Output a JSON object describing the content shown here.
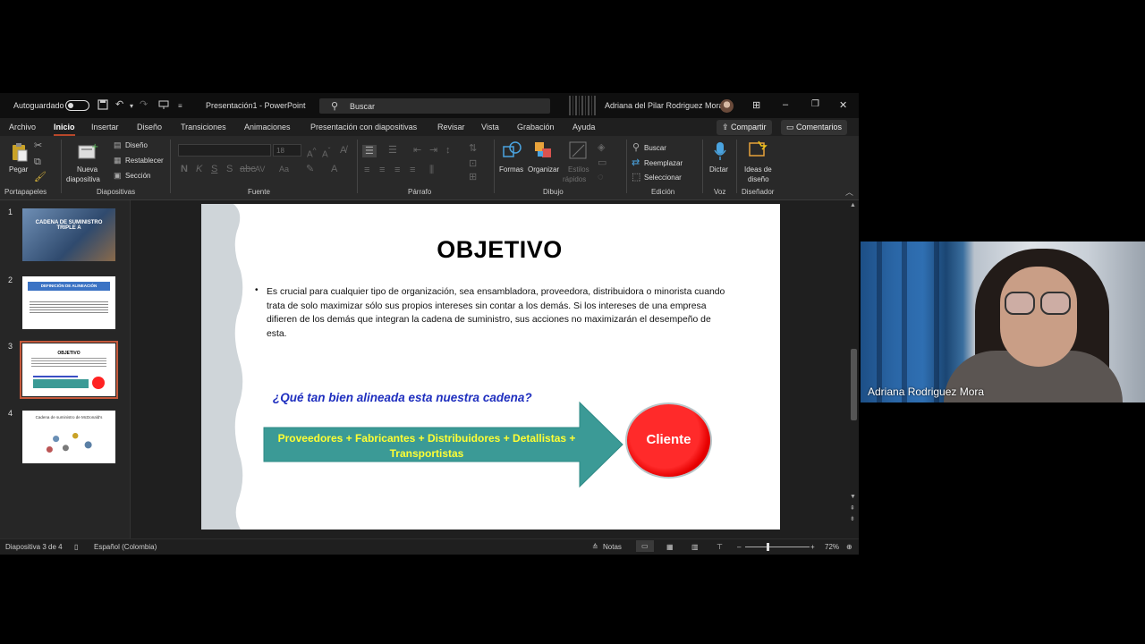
{
  "titlebar": {
    "autosave_label": "Autoguardado",
    "doc_title": "Presentación1  -  PowerPoint",
    "search_placeholder": "Buscar",
    "user_name": "Adriana del Pilar Rodriguez Mora"
  },
  "menu": {
    "tabs": [
      "Archivo",
      "Inicio",
      "Insertar",
      "Diseño",
      "Transiciones",
      "Animaciones",
      "Presentación con diapositivas",
      "Revisar",
      "Vista",
      "Grabación",
      "Ayuda"
    ],
    "active_tab": "Inicio",
    "share_label": "Compartir",
    "comments_label": "Comentarios"
  },
  "ribbon": {
    "groups": [
      "Portapapeles",
      "Diapositivas",
      "Fuente",
      "Párrafo",
      "Dibujo",
      "Edición",
      "Voz",
      "Diseñador"
    ],
    "paste": "Pegar",
    "new_slide_line1": "Nueva",
    "new_slide_line2": "diapositiva",
    "layout": "Diseño",
    "reset": "Restablecer",
    "section": "Sección",
    "font_size": "18",
    "shapes": "Formas",
    "arrange": "Organizar",
    "quick_styles_line1": "Estilos",
    "quick_styles_line2": "rápidos",
    "find": "Buscar",
    "replace": "Reemplazar",
    "select": "Seleccionar",
    "dictate": "Dictar",
    "design_ideas_line1": "Ideas de",
    "design_ideas_line2": "diseño"
  },
  "thumbnails": [
    {
      "num": "1",
      "title": "CADENA DE SUMINISTRO TRIPLE A"
    },
    {
      "num": "2",
      "title": "DEFINICIÓN DE ALINEACIÓN"
    },
    {
      "num": "3",
      "title": "OBJETIVO"
    },
    {
      "num": "4",
      "title": "Cadena de suministro de McDonald's"
    }
  ],
  "slide": {
    "title": "OBJETIVO",
    "body": "Es crucial para cualquier tipo de organización, sea ensambladora, proveedora, distribuidora o minorista cuando trata de solo maximizar sólo sus propios intereses sin contar a los demás. Si los intereses de una empresa difieren de los demás que integran la cadena de suministro, sus acciones no maximizarán el desempeño de esta.",
    "question": "¿Qué tan bien alineada esta nuestra cadena?",
    "arrow_text": "Proveedores + Fabricantes  + Distribuidores + Detallistas + Transportistas",
    "circle_text": "Cliente"
  },
  "statusbar": {
    "slide_counter": "Diapositiva 3 de 4",
    "language": "Español (Colombia)",
    "notes": "Notas",
    "zoom": "72%"
  },
  "webcam": {
    "participant_name": "Adriana Rodriguez Mora"
  },
  "colors": {
    "accent": "#b7472a",
    "arrow_fill": "#3b9a96",
    "question_blue": "#1f2fbf",
    "circle_red": "#ff1a1a"
  }
}
